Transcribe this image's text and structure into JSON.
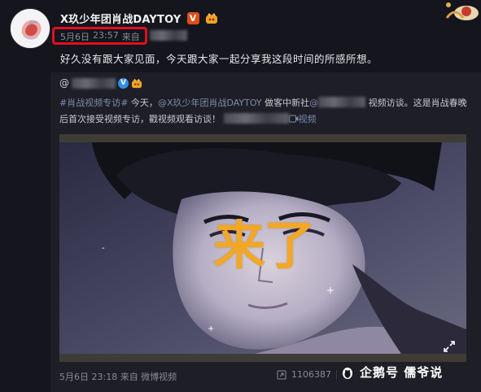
{
  "post": {
    "username": "X玖少年团肖战DAYTOY",
    "v_badge": "V",
    "meta": {
      "date": "5月6日",
      "time": "23:57",
      "from_label": "来自"
    },
    "text": "好久没有跟大家见面，今天跟大家一起分享我这段时间的所感所想。"
  },
  "repost": {
    "author_prefix": "@",
    "badge": "V",
    "text": {
      "hashtag": "#肖战视频专访#",
      "part1": " 今天，",
      "mention": "@X玖少年团肖战DAYTOY",
      "part2": " 做客中新社",
      "part3_prefix": "@",
      "part3": " 视频访谈。这是肖战春晚后首次接受视频专访，戳视频观看访谈！ ",
      "video_link": "视频"
    },
    "video": {
      "caption": "来了"
    },
    "footer": {
      "meta": "5月6日 23:18 来自 微博视频",
      "share_count": "1106387"
    }
  },
  "watermark": {
    "text": "企鹅号 儒爷说"
  },
  "colors": {
    "background": "#15151d",
    "repost_bg": "#1e1e26",
    "highlight_red": "#e00f1e",
    "caption_orange": "#f3a727",
    "link": "#7d8bb0",
    "badge_orange": "#e14d17",
    "badge_blue": "#2f8fe8"
  },
  "icons": {
    "vip": "v-badge-icon",
    "member": "member-crown-icon",
    "verified": "blue-v-icon",
    "share": "share-icon",
    "video": "video-icon",
    "fullscreen": "fullscreen-icon",
    "watermark": "penguin-icon"
  }
}
